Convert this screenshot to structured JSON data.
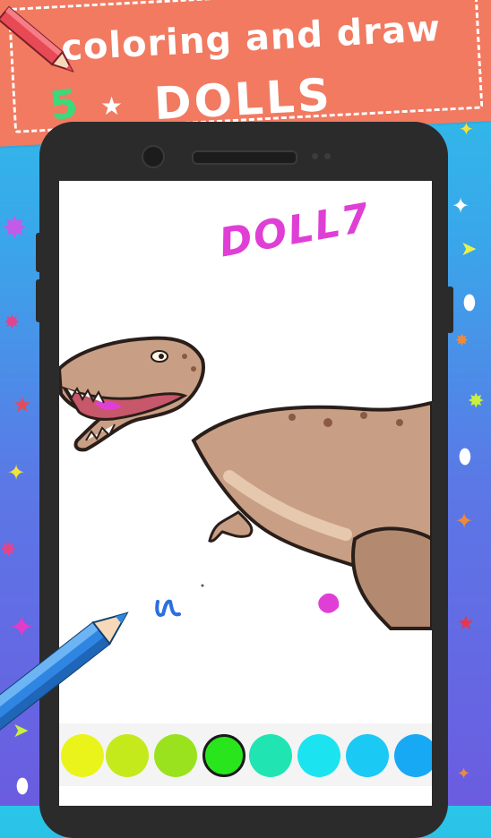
{
  "banner": {
    "title_line1": "coloring and draw",
    "title_line2": "DOLLS",
    "doodle_number": "5",
    "colors": {
      "background": "#f17a61",
      "text": "#ffffff"
    }
  },
  "canvas": {
    "handwritten_text": "DOLL7",
    "picture": "t-rex-dinosaur",
    "stroke_color": "#e03fd6"
  },
  "palette": {
    "swatches": [
      {
        "color": "#eaf41a",
        "selected": false
      },
      {
        "color": "#c4ea1c",
        "selected": false
      },
      {
        "color": "#9be21e",
        "selected": false
      },
      {
        "color": "#29e61c",
        "selected": true
      },
      {
        "color": "#20e5b3",
        "selected": false
      },
      {
        "color": "#1ce3f0",
        "selected": false
      },
      {
        "color": "#1ac9f4",
        "selected": false
      },
      {
        "color": "#17a9f4",
        "selected": false
      }
    ]
  },
  "colors": {
    "bg_top": "#29c6e8",
    "bg_bottom": "#6b5ce0",
    "phone": "#2b2b2b"
  }
}
